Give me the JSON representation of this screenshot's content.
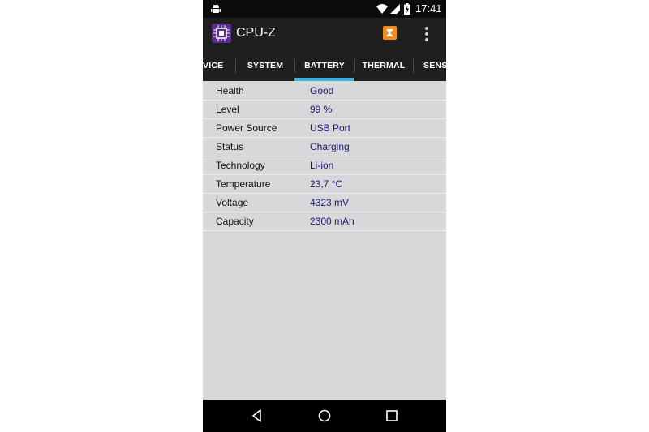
{
  "statusbar": {
    "time": "17:41"
  },
  "app": {
    "title": "CPU-Z"
  },
  "tabs": [
    {
      "label": "VICE",
      "selected": false
    },
    {
      "label": "SYSTEM",
      "selected": false
    },
    {
      "label": "BATTERY",
      "selected": true
    },
    {
      "label": "THERMAL",
      "selected": false
    },
    {
      "label": "SENS",
      "selected": false
    }
  ],
  "battery": [
    {
      "label": "Health",
      "value": "Good"
    },
    {
      "label": "Level",
      "value": "99 %"
    },
    {
      "label": "Power Source",
      "value": "USB Port"
    },
    {
      "label": "Status",
      "value": "Charging"
    },
    {
      "label": "Technology",
      "value": "Li-ion"
    },
    {
      "label": "Temperature",
      "value": "23,7 °C"
    },
    {
      "label": "Voltage",
      "value": "4323 mV"
    },
    {
      "label": "Capacity",
      "value": "2300 mAh"
    }
  ],
  "colors": {
    "accent": "#33b5e5",
    "value_text": "#1a1a78",
    "app_bar": "#1f1f20"
  },
  "icons": {
    "status_left": "android-icon",
    "wifi": "wifi-icon",
    "signal": "signal-icon",
    "battery": "battery-charging-icon",
    "share": "share-icon",
    "overflow": "overflow-menu-icon",
    "back": "back-icon",
    "home": "home-icon",
    "recents": "recents-icon"
  }
}
